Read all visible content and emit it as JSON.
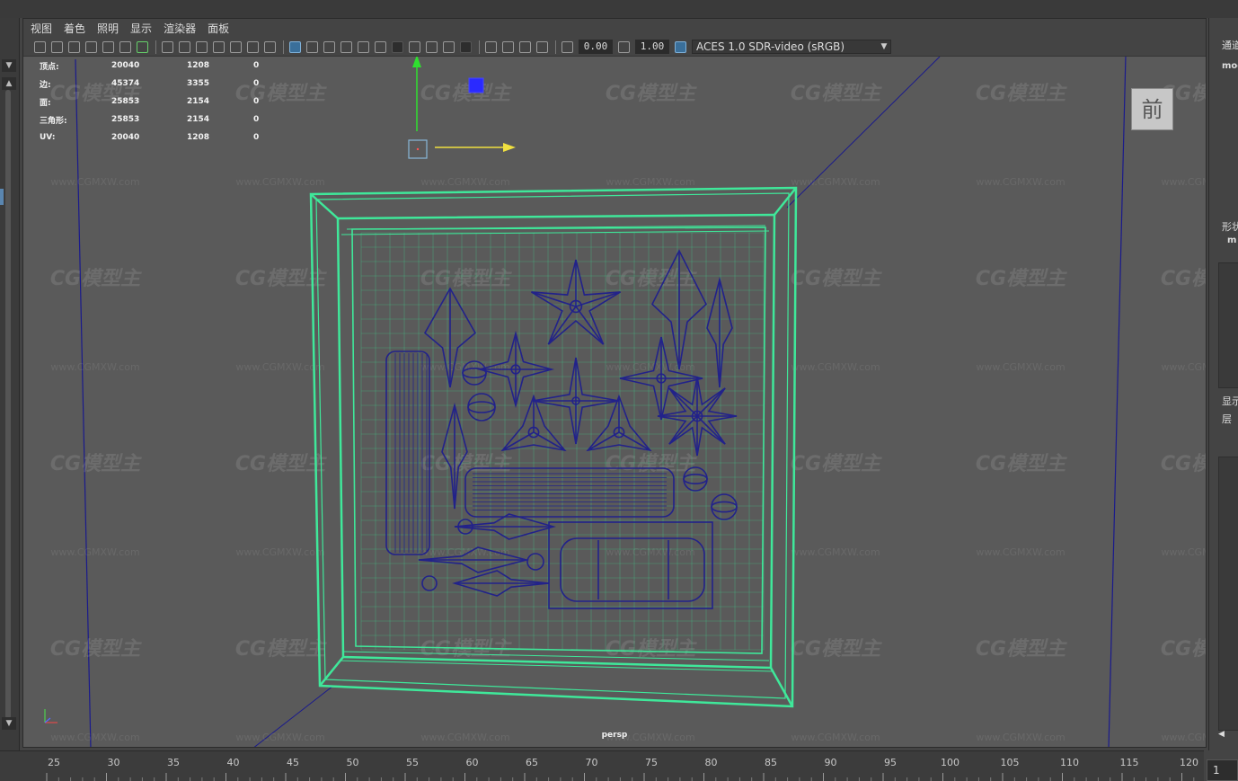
{
  "menu": [
    "视图",
    "着色",
    "照明",
    "显示",
    "渲染器",
    "面板"
  ],
  "toolbar": {
    "exposure_value": "0.00",
    "gamma_value": "1.00",
    "color_management": "ACES 1.0 SDR-video (sRGB)"
  },
  "hud": {
    "rows": [
      {
        "label": "顶点:",
        "v1": "20040",
        "v2": "1208",
        "v3": "0"
      },
      {
        "label": "边:",
        "v1": "45374",
        "v2": "3355",
        "v3": "0"
      },
      {
        "label": "面:",
        "v1": "25853",
        "v2": "2154",
        "v3": "0"
      },
      {
        "label": "三角形:",
        "v1": "25853",
        "v2": "2154",
        "v3": "0"
      },
      {
        "label": "UV:",
        "v1": "20040",
        "v2": "1208",
        "v3": "0"
      }
    ]
  },
  "view_cube_label": "前",
  "camera_label": "persp",
  "watermark": {
    "text": "CG模型主",
    "url": "www.CGMXW.com"
  },
  "right_panel": {
    "tab_label": "通道",
    "object_name": "mod",
    "shape_label": "形状",
    "shape_name": "m",
    "display_label": "显示",
    "layer_label": "层"
  },
  "timeline": {
    "ticks": [
      "25",
      "30",
      "35",
      "40",
      "45",
      "50",
      "55",
      "60",
      "65",
      "70",
      "75",
      "80",
      "85",
      "90",
      "95",
      "100",
      "105",
      "110",
      "115",
      "120"
    ],
    "current_frame": "1"
  },
  "colors": {
    "wireframe": "#3fe89a",
    "mesh": "#22228a",
    "grid": "#1a1a8c",
    "manip_y": "#2fe02f",
    "manip_x": "#f0e040",
    "manip_z": "#2a2aff"
  }
}
